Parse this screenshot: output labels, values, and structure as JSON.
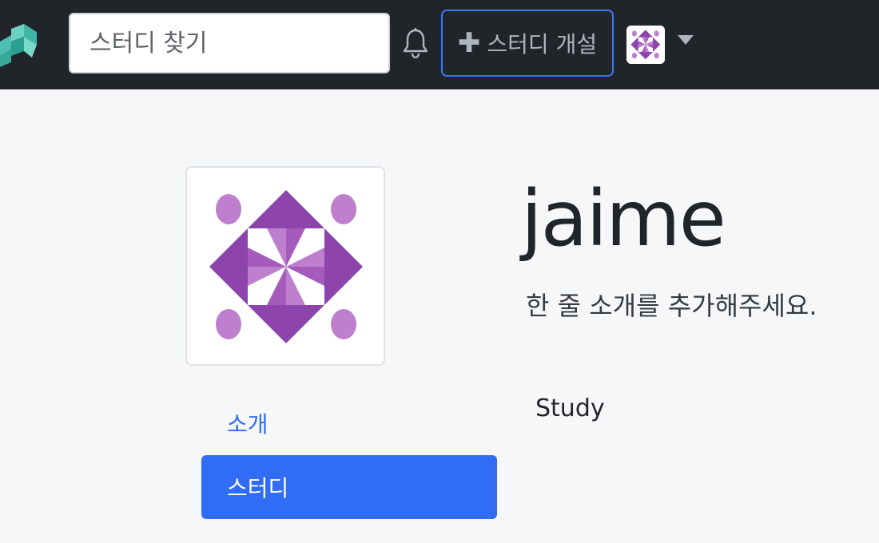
{
  "navbar": {
    "search_placeholder": "스터디 찾기",
    "create_button_label": "스터디 개설",
    "create_button_icon": "plus-icon",
    "notification_icon": "bell-icon",
    "profile_menu_icon": "caret-down-icon",
    "colors": {
      "background": "#212529",
      "button_border": "#3a78f2"
    }
  },
  "profile": {
    "username": "jaime",
    "bio_placeholder": "한 줄 소개를 추가해주세요.",
    "avatar_icon": "identicon-avatar",
    "avatar_color": "#8e44ad"
  },
  "profile_nav": {
    "items": [
      {
        "label": "소개",
        "active": false
      },
      {
        "label": "스터디",
        "active": true
      }
    ],
    "active_color": "#316cf4"
  },
  "content": {
    "section_title": "Study"
  }
}
